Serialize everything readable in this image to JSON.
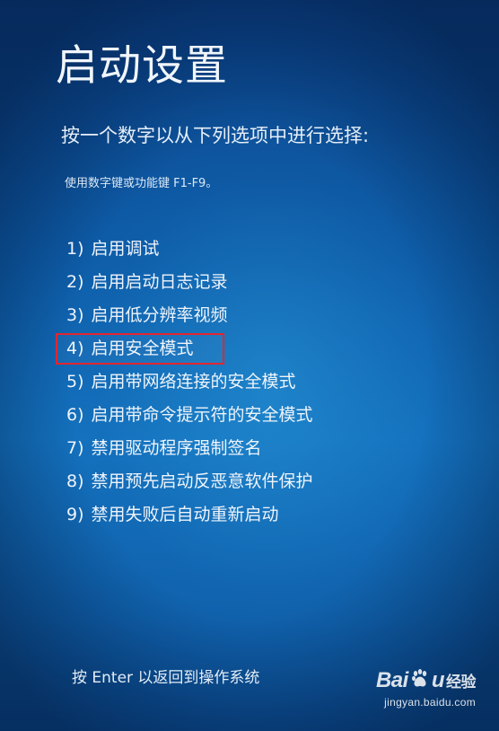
{
  "screen": {
    "title": "启动设置",
    "subtitle": "按一个数字以从下列选项中进行选择:",
    "hint": "使用数字键或功能键 F1-F9。"
  },
  "options": [
    {
      "number": "1)",
      "label": "启用调试"
    },
    {
      "number": "2)",
      "label": "启用启动日志记录"
    },
    {
      "number": "3)",
      "label": "启用低分辨率视频"
    },
    {
      "number": "4)",
      "label": "启用安全模式"
    },
    {
      "number": "5)",
      "label": "启用带网络连接的安全模式"
    },
    {
      "number": "6)",
      "label": "启用带命令提示符的安全模式"
    },
    {
      "number": "7)",
      "label": "禁用驱动程序强制签名"
    },
    {
      "number": "8)",
      "label": "禁用预先启动反恶意软件保护"
    },
    {
      "number": "9)",
      "label": "禁用失败后自动重新启动"
    }
  ],
  "highlighted_option_index": 3,
  "highlight_color": "#e3262e",
  "footer": {
    "text": "按 Enter 以返回到操作系统"
  },
  "watermark": {
    "logo_left": "Bai",
    "logo_icon": "baidu-paw-icon",
    "logo_right": "u",
    "logo_suffix": "经验",
    "url": "jingyan.baidu.com"
  },
  "colors": {
    "background_top": "#0a3f84",
    "background_mid": "#1372bf",
    "text": "#eef4fb"
  }
}
